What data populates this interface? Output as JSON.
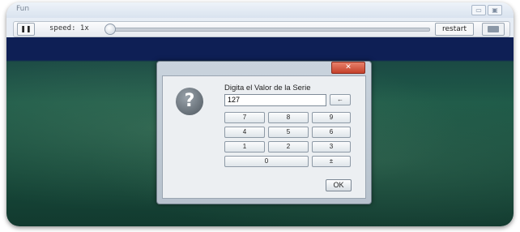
{
  "window": {
    "title": "Fun",
    "minimize_label": "▭",
    "maximize_label": "▣",
    "close_label": "✕"
  },
  "toolbar": {
    "pause_label": "❚❚",
    "speed_label": "speed: 1x",
    "speed_value": "1x",
    "restart_label": "restart",
    "snapshot_icon": "camera-icon"
  },
  "dialog": {
    "close_label": "✕",
    "icon": "question-icon",
    "icon_glyph": "?",
    "prompt": "Digita el Valor de la Serie",
    "input_value": "127",
    "backspace_label": "←",
    "keys": [
      "7",
      "8",
      "9",
      "4",
      "5",
      "6",
      "1",
      "2",
      "3",
      "0",
      "±"
    ],
    "ok_label": "OK"
  },
  "colors": {
    "sky": "#0e1f55",
    "water": "#1e5a48",
    "dialog_close": "#c5412b"
  }
}
